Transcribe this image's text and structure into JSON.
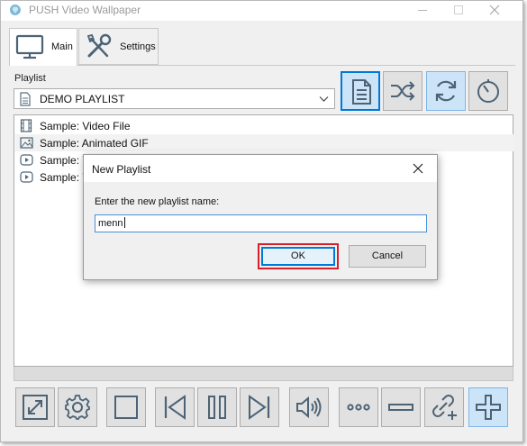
{
  "window": {
    "title": "PUSH Video Wallpaper"
  },
  "tabs": [
    {
      "label": "Main",
      "icon": "monitor-icon",
      "selected": true
    },
    {
      "label": "Settings",
      "icon": "tools-icon",
      "selected": false
    }
  ],
  "playlist": {
    "label": "Playlist",
    "selected": "DEMO PLAYLIST",
    "items": [
      {
        "label": "Sample: Video File",
        "icon": "film-icon"
      },
      {
        "label": "Sample: Animated GIF",
        "icon": "image-icon"
      },
      {
        "label": "Sample: Y",
        "icon": "youtube-icon"
      },
      {
        "label": "Sample: Y",
        "icon": "youtube-icon"
      }
    ]
  },
  "toolbar": {
    "buttons": [
      "playlist-document-icon",
      "shuffle-icon",
      "repeat-icon",
      "timer-icon"
    ]
  },
  "controls": {
    "buttons": [
      "fullscreen-icon",
      "settings-gear-icon",
      "stop-icon",
      "previous-icon",
      "pause-icon",
      "next-icon",
      "volume-icon",
      "more-icon",
      "remove-icon",
      "add-url-icon",
      "add-icon"
    ]
  },
  "dialog": {
    "title": "New Playlist",
    "prompt": "Enter the new playlist name:",
    "input_value": "menn",
    "ok_label": "OK",
    "cancel_label": "Cancel"
  },
  "colors": {
    "accent": "#0078d7",
    "highlight_box": "#d6202a",
    "pressed_bg": "#cce4f7",
    "icon_color": "#5a6f80"
  }
}
